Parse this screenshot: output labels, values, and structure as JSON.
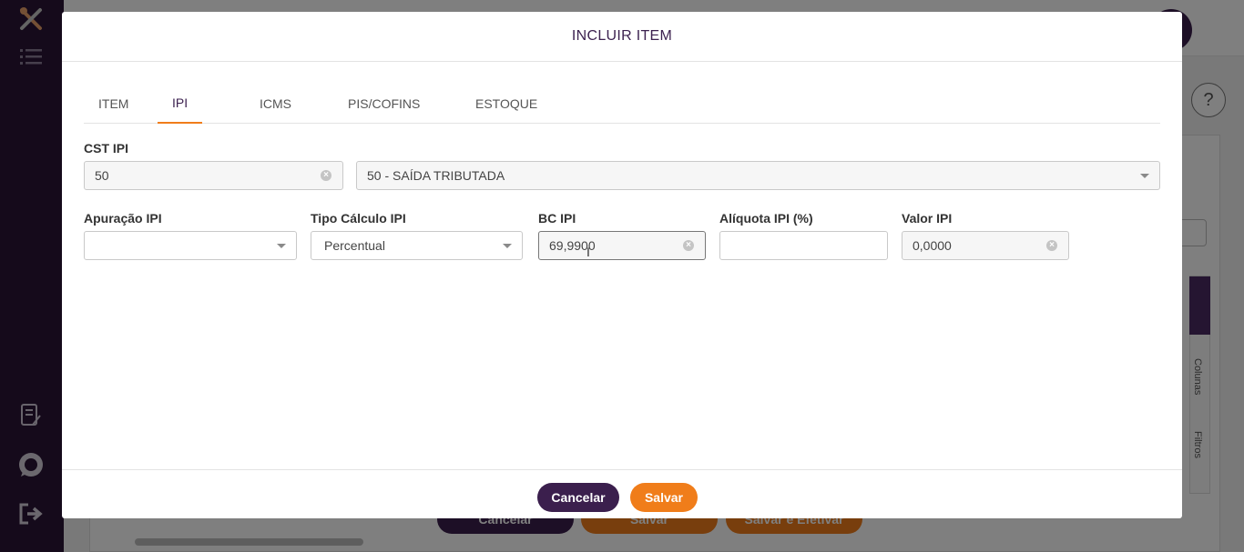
{
  "modal": {
    "title": "INCLUIR ITEM",
    "tabs": [
      {
        "label": "ITEM",
        "active": false
      },
      {
        "label": "IPI",
        "active": true
      },
      {
        "label": "ICMS",
        "active": false
      },
      {
        "label": "PIS/COFINS",
        "active": false
      },
      {
        "label": "ESTOQUE",
        "active": false
      }
    ],
    "form": {
      "cst_ipi": {
        "label": "CST IPI",
        "value": "50",
        "description": "50 - SAÍDA TRIBUTADA"
      },
      "apuracao_ipi": {
        "label": "Apuração IPI",
        "value": ""
      },
      "tipo_calculo_ipi": {
        "label": "Tipo Cálculo IPI",
        "value": "Percentual"
      },
      "bc_ipi": {
        "label": "BC IPI",
        "value": "69,9900"
      },
      "aliquota_ipi": {
        "label": "Alíquota IPI (%)",
        "value": ""
      },
      "valor_ipi": {
        "label": "Valor IPI",
        "value": "0,0000"
      }
    },
    "footer": {
      "cancel_label": "Cancelar",
      "save_label": "Salvar"
    }
  },
  "background": {
    "help_label": "?",
    "side_tabs": {
      "columns": "Colunas",
      "filters": "Filtros"
    },
    "buttons": {
      "cancel": "Cancelar",
      "save": "Salvar",
      "save_and_effect": "Salvar e Efetivar"
    }
  },
  "icons": {
    "logo": "tools-logo-icon",
    "menu": "list-menu-icon",
    "notes": "document-edit-icon",
    "whatsapp": "whatsapp-icon",
    "logout": "logout-icon"
  },
  "colors": {
    "primary": "#3b1f4d",
    "accent": "#f07d1a",
    "sidebar": "#2a1436"
  }
}
